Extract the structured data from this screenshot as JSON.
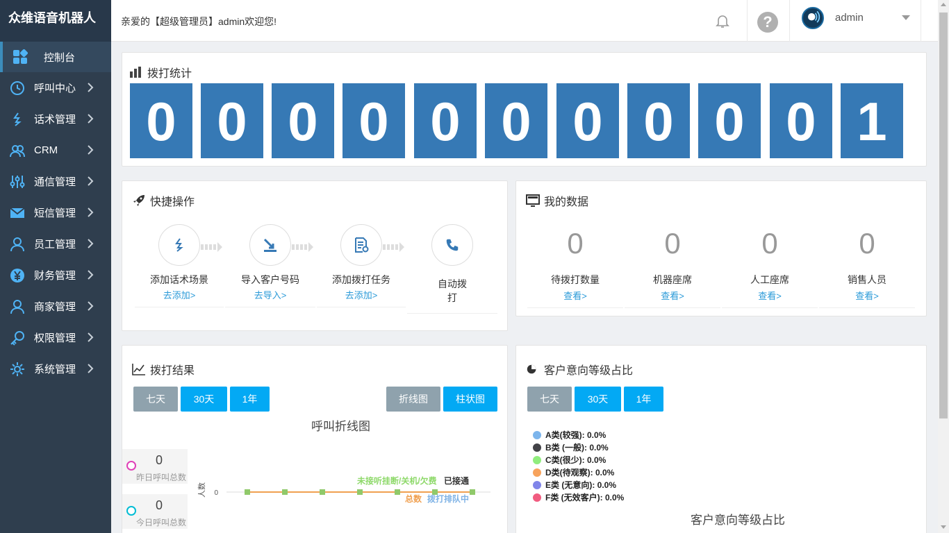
{
  "app": {
    "brand": "众维语音机器人"
  },
  "header": {
    "welcome": "亲爱的【超级管理员】admin欢迎您!",
    "username": "admin",
    "help_glyph": "?"
  },
  "sidebar": {
    "items": [
      {
        "label": "控制台",
        "icon": "dashboard-icon"
      },
      {
        "label": "呼叫中心",
        "icon": "clock-icon"
      },
      {
        "label": "话术管理",
        "icon": "script-icon"
      },
      {
        "label": "CRM",
        "icon": "users-icon"
      },
      {
        "label": "通信管理",
        "icon": "sliders-icon"
      },
      {
        "label": "短信管理",
        "icon": "mail-icon"
      },
      {
        "label": "员工管理",
        "icon": "user-icon"
      },
      {
        "label": "财务管理",
        "icon": "yen-icon"
      },
      {
        "label": "商家管理",
        "icon": "user-icon"
      },
      {
        "label": "权限管理",
        "icon": "key-icon"
      },
      {
        "label": "系统管理",
        "icon": "gear-icon"
      }
    ]
  },
  "dial_stats": {
    "title": "拨打统计",
    "digits": [
      "0",
      "0",
      "0",
      "0",
      "0",
      "0",
      "0",
      "0",
      "0",
      "0",
      "1"
    ]
  },
  "quick_ops": {
    "title": "快捷操作",
    "steps": [
      {
        "name": "添加话术场景",
        "link": "去添加>"
      },
      {
        "name": "导入客户号码",
        "link": "去导入>"
      },
      {
        "name": "添加拨打任务",
        "link": "去添加>"
      },
      {
        "name": "自动拨打",
        "link": ""
      }
    ]
  },
  "my_data": {
    "title": "我的数据",
    "items": [
      {
        "value": "0",
        "label": "待拨打数量",
        "link": "查看>"
      },
      {
        "value": "0",
        "label": "机器座席",
        "link": "查看>"
      },
      {
        "value": "0",
        "label": "人工座席",
        "link": "查看>"
      },
      {
        "value": "0",
        "label": "销售人员",
        "link": "查看>"
      }
    ]
  },
  "dial_result": {
    "title": "拨打结果",
    "range_buttons": [
      "七天",
      "30天",
      "1年"
    ],
    "type_buttons": [
      "折线图",
      "柱状图"
    ],
    "chart_title": "呼叫折线图",
    "stats": [
      {
        "value": "0",
        "label": "昨日呼叫总数",
        "color": "#e040b8"
      },
      {
        "value": "0",
        "label": "今日呼叫总数",
        "color": "#00bcd4"
      }
    ],
    "ylabel": "人数",
    "ytick": "0",
    "legend_top": [
      {
        "label": "未接听挂断/关机/欠费",
        "color": "#8ed96a"
      },
      {
        "label": "已接通",
        "color": "#333333"
      }
    ],
    "legend_bottom": [
      {
        "label": "总数",
        "color": "#f0a050"
      },
      {
        "label": "拨打排队中",
        "color": "#7fb3e6"
      }
    ]
  },
  "intent": {
    "title": "客户意向等级占比",
    "range_buttons": [
      "七天",
      "30天",
      "1年"
    ],
    "chart_title": "客户意向等级占比",
    "legend": [
      {
        "label": "A类(较强): 0.0%",
        "color": "#7cb5ec"
      },
      {
        "label": "B类 (一般): 0.0%",
        "color": "#434348"
      },
      {
        "label": "C类(很少): 0.0%",
        "color": "#90ed7d"
      },
      {
        "label": "D类(待观察): 0.0%",
        "color": "#f7a35c"
      },
      {
        "label": "E类 (无意向): 0.0%",
        "color": "#8085e9"
      },
      {
        "label": "F类 (无效客户): 0.0%",
        "color": "#f15c80"
      }
    ]
  },
  "chart_data": {
    "type": "line",
    "title": "呼叫折线图",
    "ylabel": "人数",
    "yticks": [
      "0"
    ],
    "series": [
      {
        "name": "总数",
        "values": [
          0,
          0,
          0,
          0,
          0,
          0,
          0
        ]
      },
      {
        "name": "未接听挂断/关机/欠费",
        "values": [
          0,
          0,
          0,
          0,
          0,
          0,
          0
        ]
      },
      {
        "name": "已接通",
        "values": [
          0,
          0,
          0,
          0,
          0,
          0,
          0
        ]
      },
      {
        "name": "拨打排队中",
        "values": [
          0,
          0,
          0,
          0,
          0,
          0,
          0
        ]
      }
    ]
  }
}
